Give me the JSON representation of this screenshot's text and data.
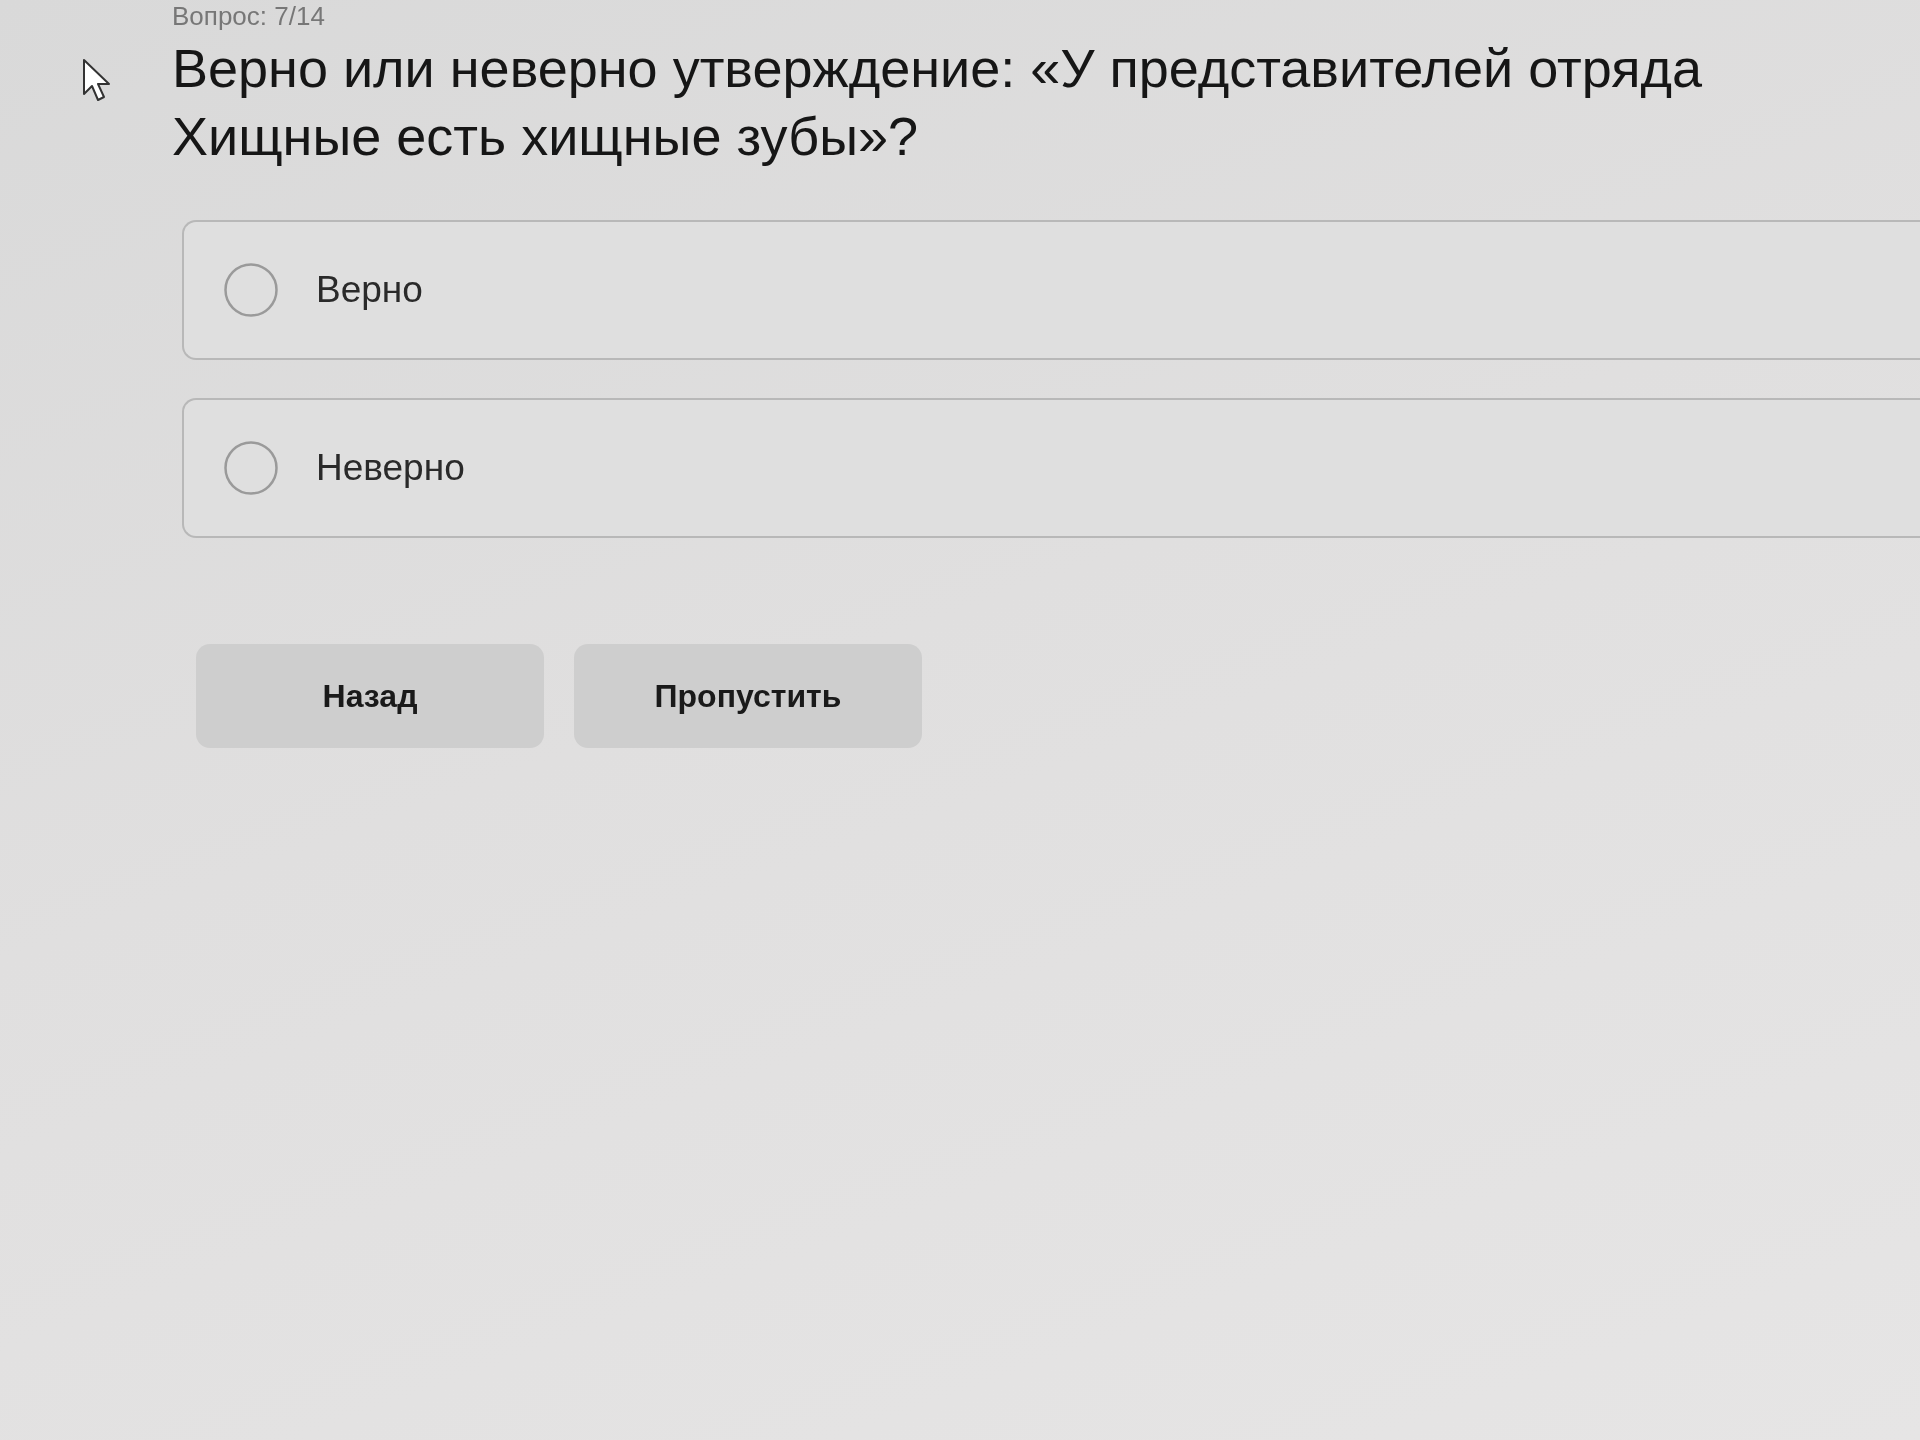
{
  "question_counter": "Вопрос: 7/14",
  "question": {
    "text": "Верно или неверно утверждение: «У представителей отряда Хищные есть хищные зубы»?"
  },
  "options": [
    {
      "label": "Верно",
      "selected": false
    },
    {
      "label": "Неверно",
      "selected": false
    }
  ],
  "buttons": [
    "Назад",
    "Пропустить"
  ]
}
